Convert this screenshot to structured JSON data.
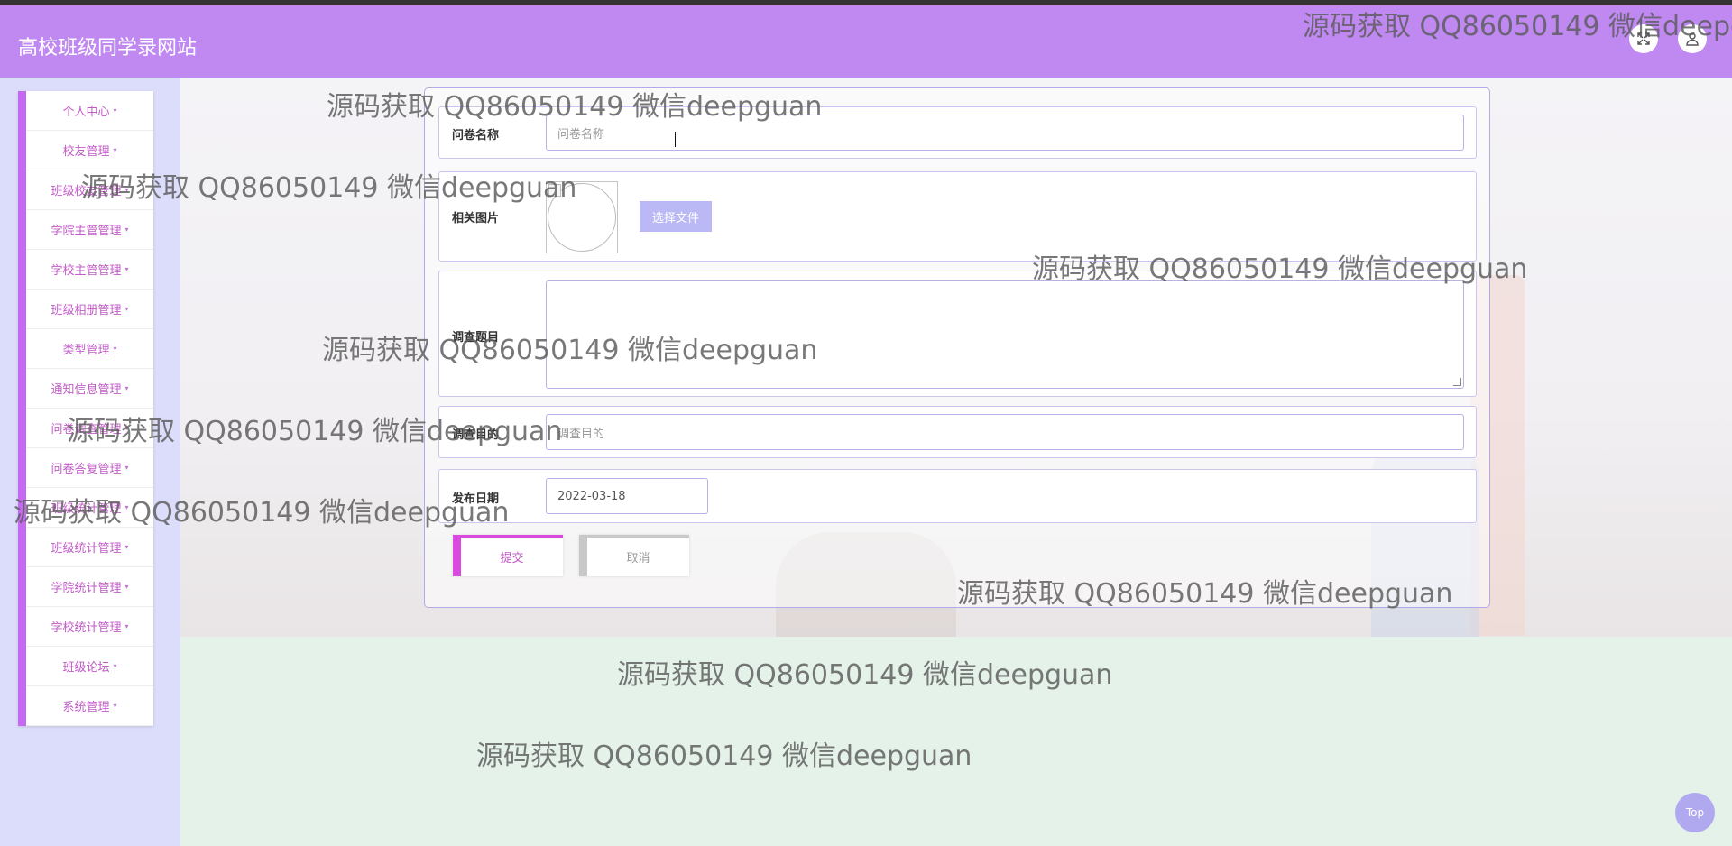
{
  "header": {
    "title": "高校班级同学录网站",
    "fullscreen_icon": "fullscreen-icon",
    "user_icon": "user-icon"
  },
  "sidebar": {
    "items": [
      {
        "label": "个人中心"
      },
      {
        "label": "校友管理"
      },
      {
        "label": "班级校友管理"
      },
      {
        "label": "学院主管管理"
      },
      {
        "label": "学校主管管理"
      },
      {
        "label": "班级相册管理"
      },
      {
        "label": "类型管理"
      },
      {
        "label": "通知信息管理"
      },
      {
        "label": "问卷调查管理"
      },
      {
        "label": "问卷答复管理"
      },
      {
        "label": "班级统计管理"
      },
      {
        "label": "班级统计管理"
      },
      {
        "label": "学院统计管理"
      },
      {
        "label": "学校统计管理"
      },
      {
        "label": "班级论坛"
      },
      {
        "label": "系统管理"
      }
    ],
    "caret": "▾"
  },
  "form": {
    "name_label": "问卷名称",
    "name_placeholder": "问卷名称",
    "image_label": "相关图片",
    "choose_file": "选择文件",
    "topic_label": "调查题目",
    "purpose_label": "调查目的",
    "purpose_placeholder": "调查目的",
    "date_label": "发布日期",
    "date_value": "2022-03-18",
    "submit": "提交",
    "cancel": "取消"
  },
  "watermark": "源码获取 QQ86050149 微信deepguan",
  "top_button": "Top",
  "colors": {
    "header": "#bf89f1",
    "sidebar_accent": "#c36af0",
    "submit_accent": "#da4ade",
    "choose_btn": "#bab8f5"
  }
}
